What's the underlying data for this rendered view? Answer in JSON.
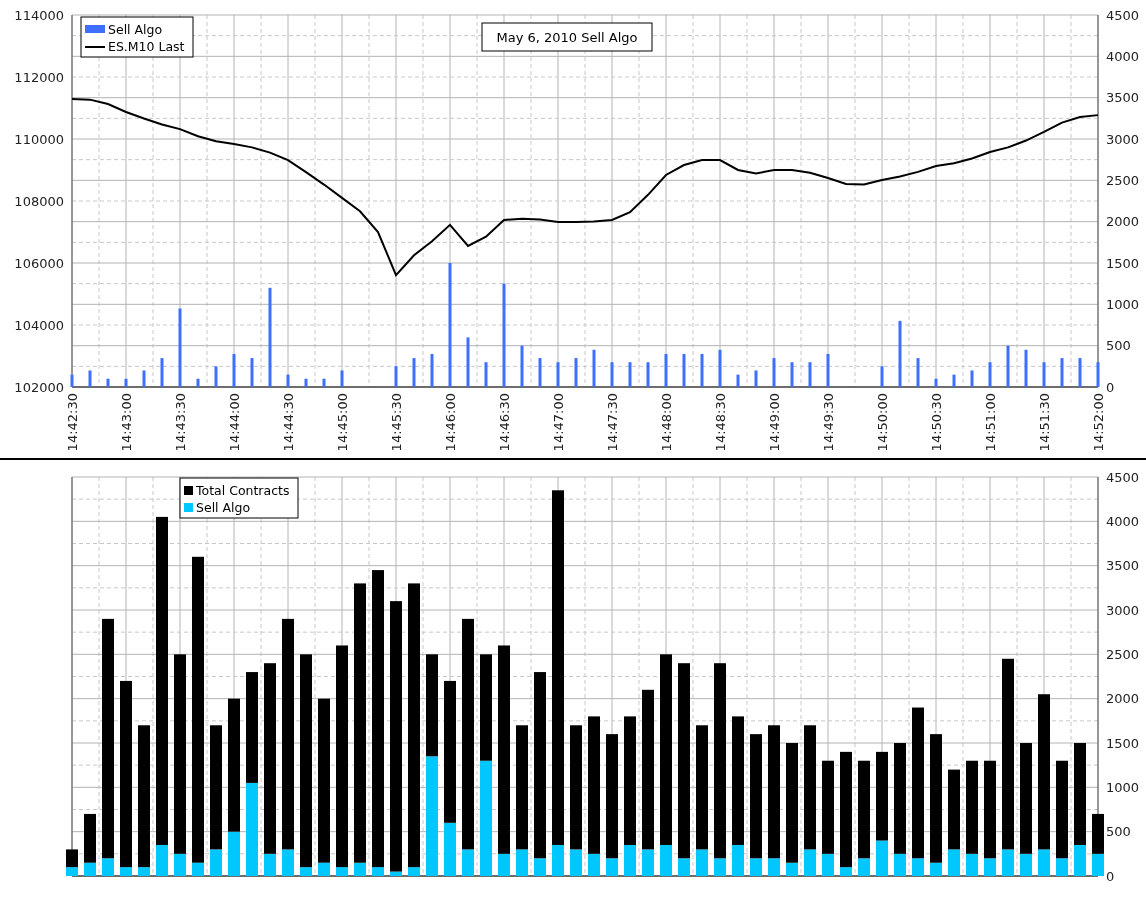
{
  "charts": [
    {
      "chart_data": {
        "type": "line",
        "title": "May 6, 2010 Sell Algo",
        "grid": true,
        "legend": true,
        "ylim": [
          102000,
          114000
        ],
        "yticks": [
          102000,
          104000,
          106000,
          108000,
          110000,
          112000,
          114000
        ],
        "y2lim": [
          0,
          4500
        ],
        "y2ticks": [
          0,
          500,
          1000,
          1500,
          2000,
          2500,
          3000,
          3500,
          4000,
          4500
        ],
        "categories": [
          "14:42:30",
          null,
          null,
          "14:43:00",
          null,
          null,
          "14:43:30",
          null,
          null,
          "14:44:00",
          null,
          null,
          "14:44:30",
          null,
          null,
          "14:45:00",
          null,
          null,
          "14:45:30",
          null,
          null,
          "14:46:00",
          null,
          null,
          "14:46:30",
          null,
          null,
          "14:47:00",
          null,
          null,
          "14:47:30",
          null,
          null,
          "14:48:00",
          null,
          null,
          "14:48:30",
          null,
          null,
          "14:49:00",
          null,
          null,
          "14:49:30",
          null,
          null,
          "14:50:00",
          null,
          null,
          "14:50:30",
          null,
          null,
          "14:51:00",
          null,
          null,
          "14:51:30",
          null,
          null,
          "14:52:00"
        ],
        "series": [
          {
            "name": "Sell Algo",
            "type": "bar",
            "axis": "y2",
            "color": "#3f6fff",
            "values": [
              150,
              200,
              100,
              100,
              200,
              350,
              950,
              100,
              250,
              400,
              350,
              1200,
              150,
              100,
              100,
              200,
              0,
              0,
              250,
              350,
              400,
              1500,
              600,
              300,
              1250,
              500,
              350,
              300,
              350,
              450,
              300,
              300,
              300,
              400,
              400,
              400,
              450,
              150,
              200,
              350,
              300,
              300,
              400,
              0,
              0,
              250,
              800,
              350,
              100,
              150,
              200,
              300,
              500,
              450,
              300,
              350,
              350,
              300
            ]
          },
          {
            "name": "ES.M10 Last",
            "type": "line",
            "color": "#000000",
            "values": [
              111290,
              111270,
              111130,
              110870,
              110660,
              110470,
              110320,
              110090,
              109930,
              109840,
              109730,
              109560,
              109320,
              108930,
              108530,
              108100,
              107670,
              107000,
              105610,
              106250,
              106700,
              107230,
              106550,
              106850,
              107390,
              107430,
              107400,
              107320,
              107320,
              107340,
              107390,
              107640,
              108200,
              108840,
              109160,
              109320,
              109320,
              109000,
              108890,
              109000,
              109000,
              108910,
              108740,
              108550,
              108530,
              108680,
              108790,
              108940,
              109130,
              109220,
              109370,
              109580,
              109730,
              109950,
              110230,
              110530,
              110710,
              110770
            ]
          }
        ]
      }
    },
    {
      "chart_data": {
        "type": "bar",
        "stacked": true,
        "grid": true,
        "legend": true,
        "ylim": [
          0,
          4500
        ],
        "yticks": [
          0,
          500,
          1000,
          1500,
          2000,
          2500,
          3000,
          3500,
          4000,
          4500
        ],
        "categories": [
          null,
          null,
          null,
          null,
          null,
          null,
          null,
          null,
          null,
          null,
          null,
          null,
          null,
          null,
          null,
          null,
          null,
          null,
          null,
          null,
          null,
          null,
          null,
          null,
          null,
          null,
          null,
          null,
          null,
          null,
          null,
          null,
          null,
          null,
          null,
          null,
          null,
          null,
          null,
          null,
          null,
          null,
          null,
          null,
          null,
          null,
          null,
          null,
          null,
          null,
          null,
          null,
          null,
          null,
          null,
          null,
          null,
          null
        ],
        "series": [
          {
            "name": "Total Contracts",
            "color": "#000000",
            "values": [
              200,
              550,
              2700,
              2100,
              1600,
              3700,
              2250,
              3450,
              1400,
              1500,
              1250,
              2150,
              2600,
              2400,
              1850,
              2500,
              3150,
              3350,
              3050,
              3200,
              1150,
              1600,
              2600,
              1200,
              2350,
              1400,
              2100,
              4000,
              1400,
              1550,
              1400,
              1450,
              1800,
              2150,
              2200,
              1400,
              2200,
              1450,
              1400,
              1500,
              1350,
              1400,
              1050,
              1300,
              1100,
              1000,
              1250,
              1700,
              1450,
              900,
              1050,
              1100,
              2150,
              1250,
              1750,
              1100,
              1150,
              450
            ]
          },
          {
            "name": "Sell Algo",
            "color": "#00c8ff",
            "values": [
              100,
              150,
              200,
              100,
              100,
              350,
              250,
              150,
              300,
              500,
              1050,
              250,
              300,
              100,
              150,
              100,
              150,
              100,
              50,
              100,
              1350,
              600,
              300,
              1300,
              250,
              300,
              200,
              350,
              300,
              250,
              200,
              350,
              300,
              350,
              200,
              300,
              200,
              350,
              200,
              200,
              150,
              300,
              250,
              100,
              200,
              400,
              250,
              200,
              150,
              300,
              250,
              200,
              300,
              250,
              300,
              200,
              350,
              250
            ]
          }
        ]
      }
    }
  ]
}
